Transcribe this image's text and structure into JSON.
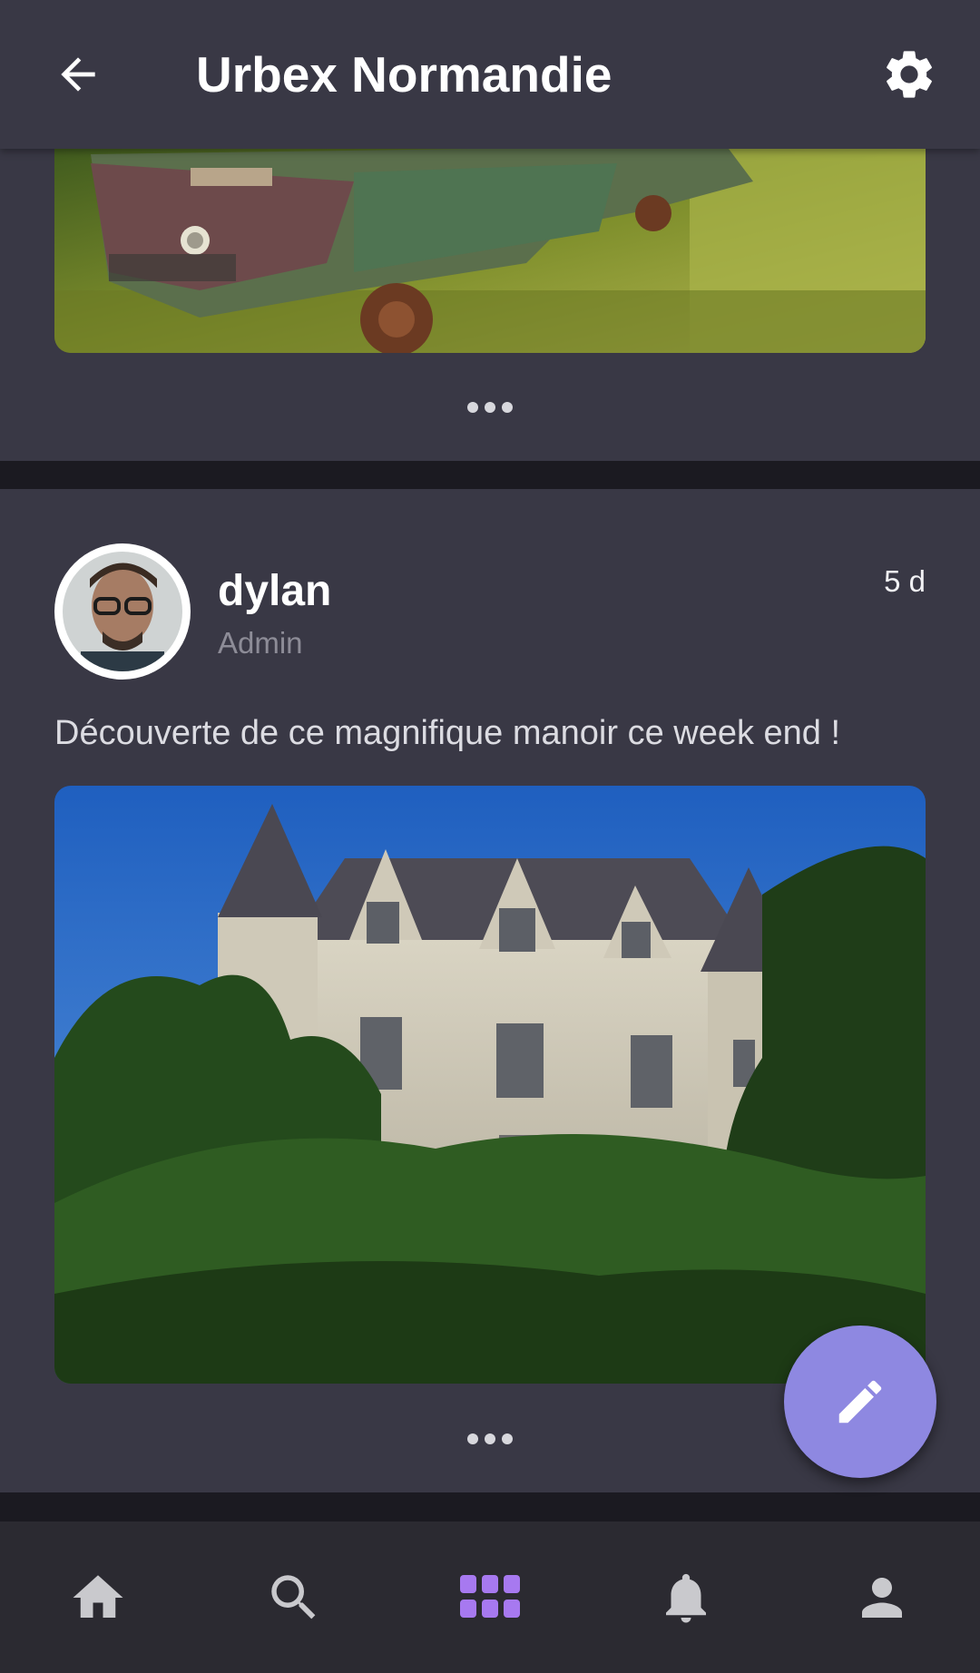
{
  "app_bar": {
    "title": "Urbex Normandie",
    "back_icon": "arrow-back-icon",
    "settings_icon": "gear-icon"
  },
  "posts": [
    {
      "image": "abandoned-jeep-photo",
      "more_icon": "more-dots-icon"
    },
    {
      "author": {
        "name": "dylan",
        "role": "Admin"
      },
      "time": "5 d",
      "text": "Découverte de ce magnifique manoir ce week end !",
      "image": "manor-photo",
      "more_icon": "more-dots-icon"
    }
  ],
  "fab": {
    "icon": "pencil-icon"
  },
  "bottom_nav": {
    "items": [
      {
        "icon": "home-icon",
        "active": false
      },
      {
        "icon": "search-icon",
        "active": false
      },
      {
        "icon": "grid-icon",
        "active": true
      },
      {
        "icon": "bell-icon",
        "active": false
      },
      {
        "icon": "person-icon",
        "active": false
      }
    ]
  },
  "colors": {
    "app_bar": "#393845",
    "card": "#393845",
    "background": "#1b1a21",
    "bottom_nav": "#2b2a31",
    "fab": "#8e88e1",
    "active_nav": "#a779f0",
    "inactive_nav": "#c9c9cd"
  }
}
